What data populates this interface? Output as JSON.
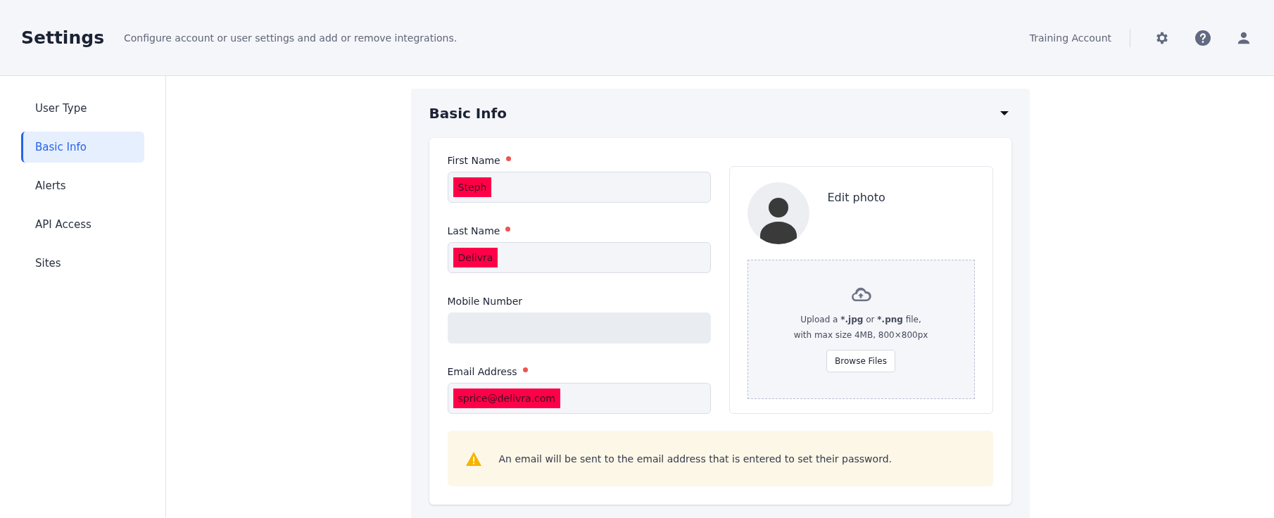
{
  "header": {
    "title": "Settings",
    "subtitle": "Configure account or user settings and add or remove integrations.",
    "account": "Training Account"
  },
  "sidebar": {
    "items": [
      {
        "label": "User Type",
        "selected": false
      },
      {
        "label": "Basic Info",
        "selected": true
      },
      {
        "label": "Alerts",
        "selected": false
      },
      {
        "label": "API Access",
        "selected": false
      },
      {
        "label": "Sites",
        "selected": false
      }
    ]
  },
  "panel": {
    "title": "Basic Info",
    "expanded": true,
    "fields": [
      {
        "label": "First Name",
        "required": true,
        "value": "Steph",
        "disabled": false
      },
      {
        "label": "Last Name",
        "required": true,
        "value": "Delivra",
        "disabled": false
      },
      {
        "label": "Mobile Number",
        "required": false,
        "disabled": true
      },
      {
        "label": "Email Address",
        "required": true,
        "value": "sprice@delivra.com",
        "disabled": false
      }
    ],
    "photo": {
      "edit_label": "Edit photo",
      "upload_lines": [
        [
          {
            "text": "Upload a ",
            "bold": false
          },
          {
            "text": "*.jpg",
            "bold": true
          },
          {
            "text": " or ",
            "bold": false
          },
          {
            "text": "*.png",
            "bold": true
          },
          {
            "text": " file,",
            "bold": false
          }
        ],
        [
          {
            "text": "with max size 4MB, 800×800px",
            "bold": false
          }
        ]
      ],
      "browse_button": "Browse Files"
    },
    "notice": "An email will be sent to the email address that is entered to set their password."
  }
}
